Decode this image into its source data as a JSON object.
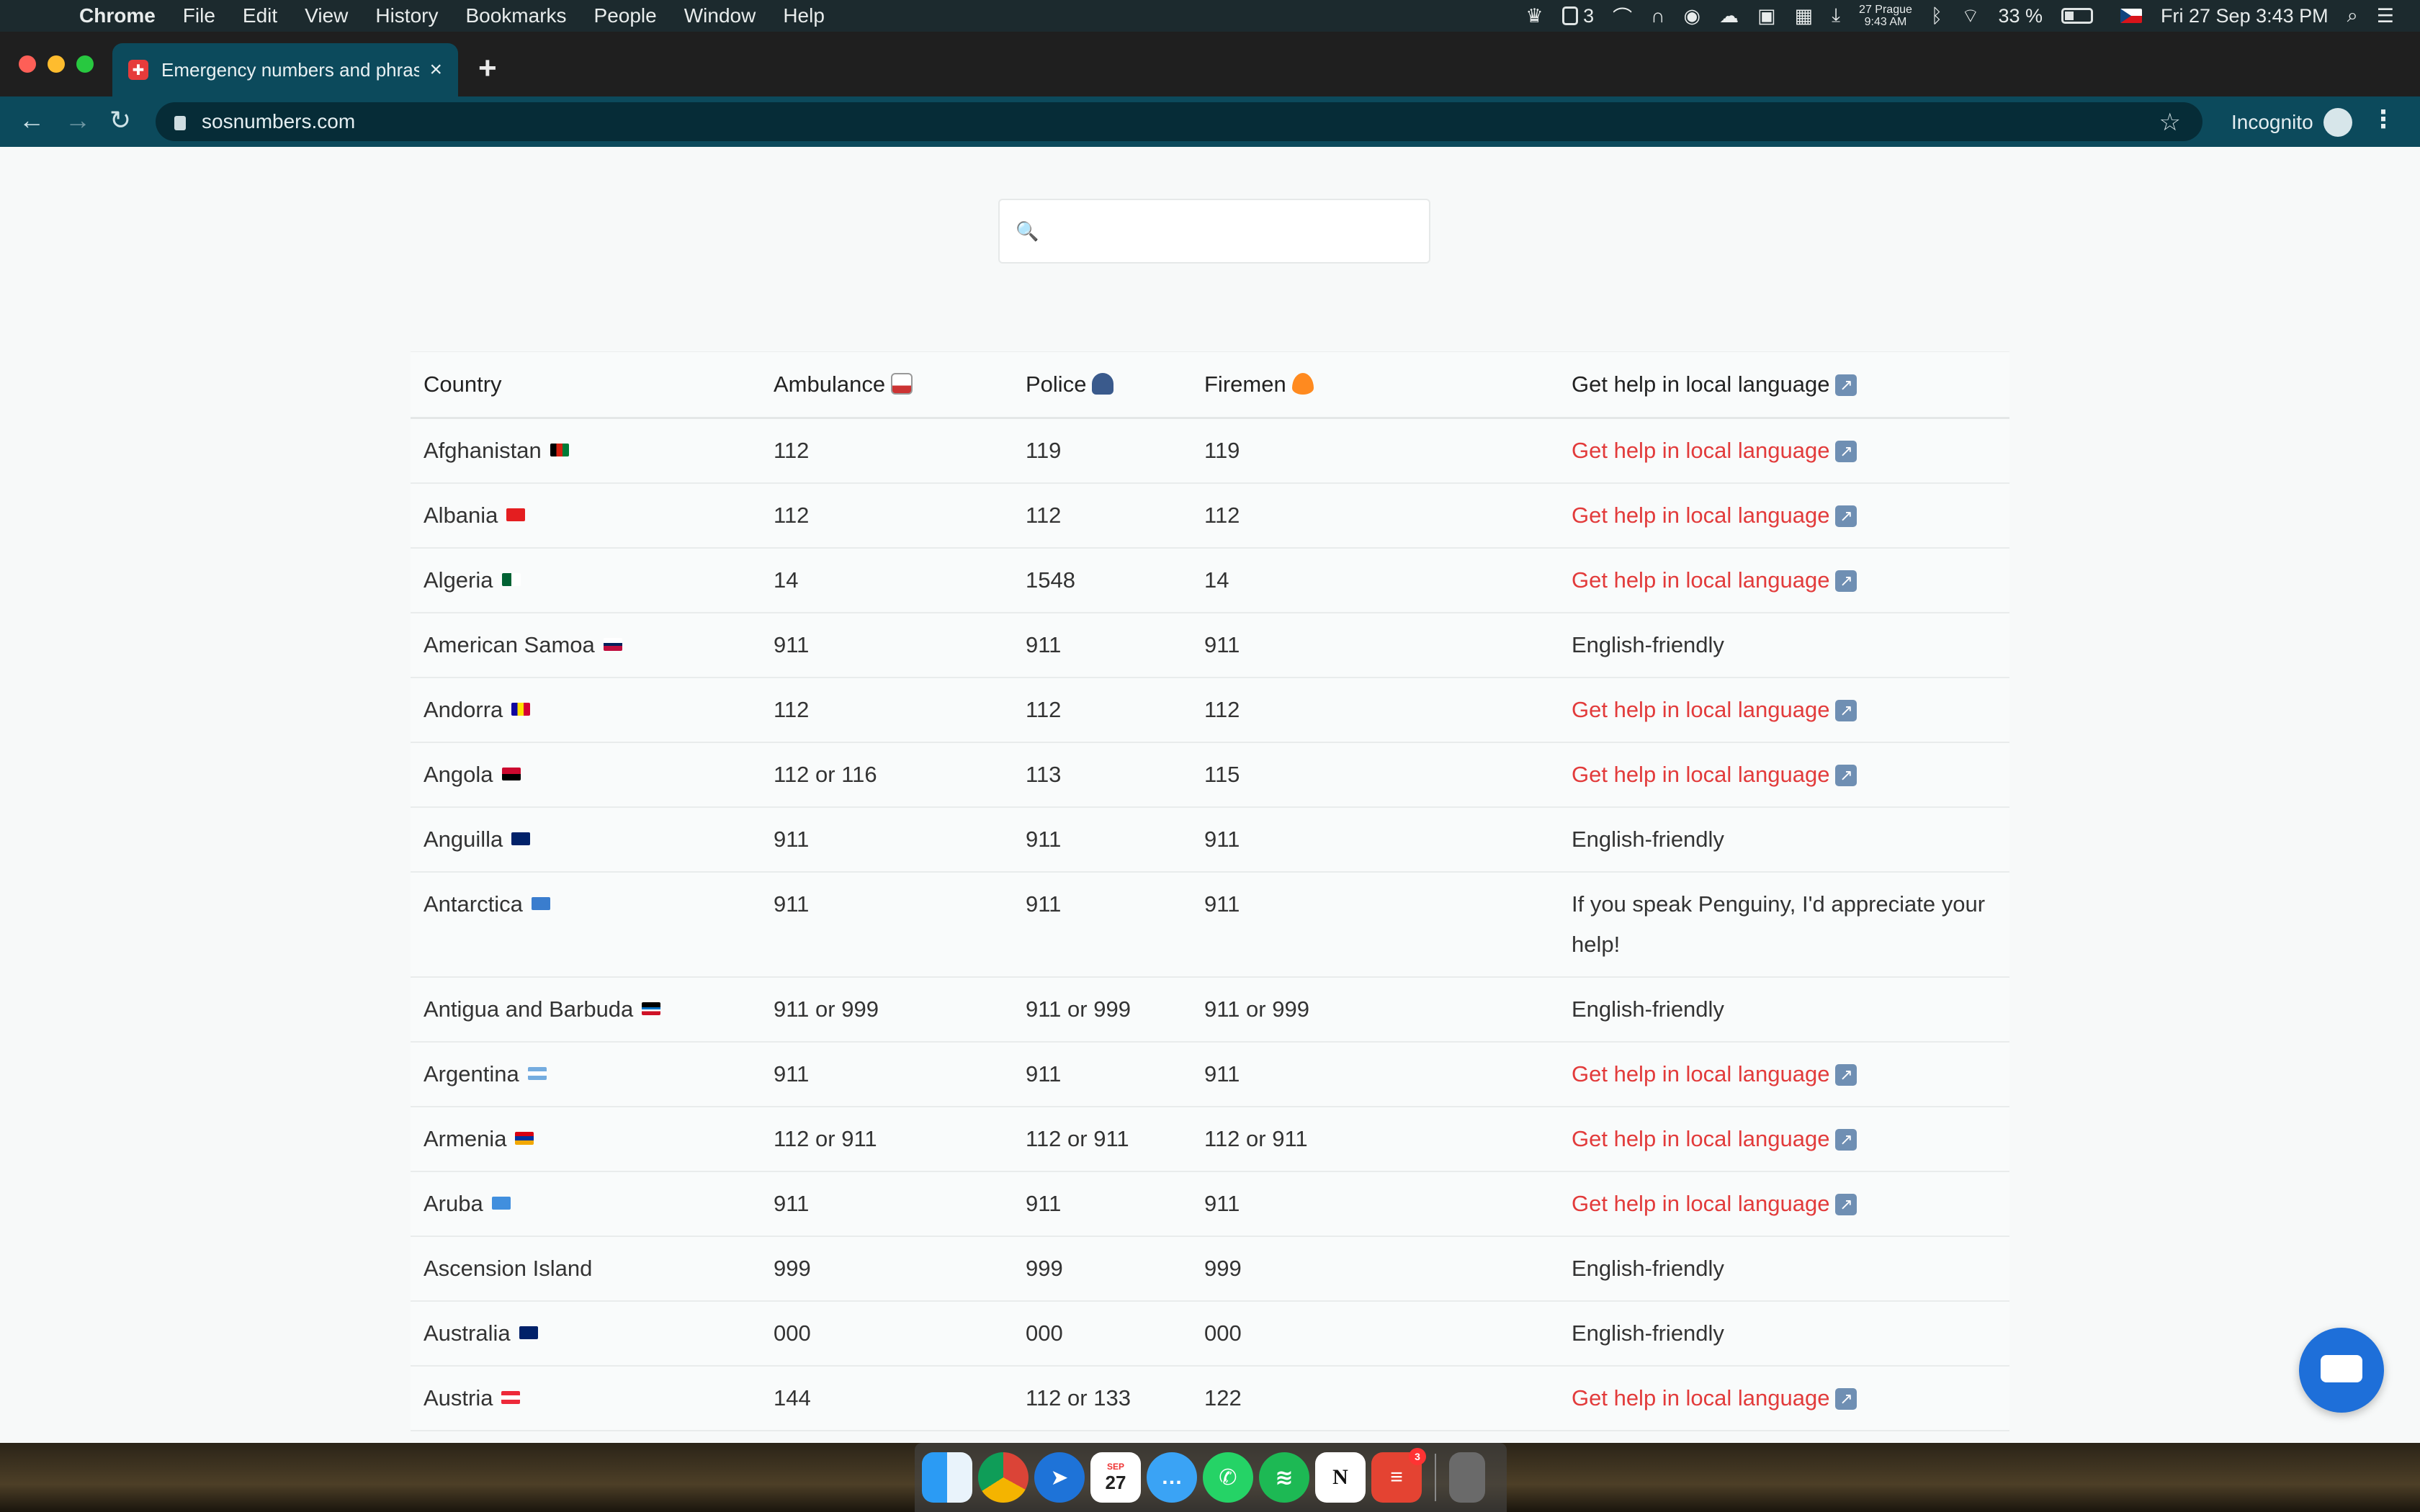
{
  "menubar": {
    "app": "Chrome",
    "items": [
      "File",
      "Edit",
      "View",
      "History",
      "Bookmarks",
      "People",
      "Window",
      "Help"
    ],
    "status": {
      "counter": "3",
      "clock_city": "27 Prague",
      "clock_time": "9:43 AM",
      "battery": "33 %",
      "datetime": "Fri 27 Sep  3:43 PM"
    }
  },
  "browser": {
    "tab_title": "Emergency numbers and phrases",
    "tab_close": "×",
    "new_tab": "+",
    "url": "sosnumbers.com",
    "incognito_label": "Incognito"
  },
  "search": {
    "placeholder": "",
    "value": ""
  },
  "table": {
    "headers": [
      "Country",
      "Ambulance",
      "Police",
      "Firemen",
      "Get help in local language"
    ],
    "rows": [
      {
        "country": "Afghanistan",
        "ambulance": "112",
        "police": "119",
        "firemen": "119",
        "help": "Get help in local language",
        "link": true
      },
      {
        "country": "Albania",
        "ambulance": "112",
        "police": "112",
        "firemen": "112",
        "help": "Get help in local language",
        "link": true
      },
      {
        "country": "Algeria",
        "ambulance": "14",
        "police": "1548",
        "firemen": "14",
        "help": "Get help in local language",
        "link": true
      },
      {
        "country": "American Samoa",
        "ambulance": "911",
        "police": "911",
        "firemen": "911",
        "help": "English-friendly",
        "link": false
      },
      {
        "country": "Andorra",
        "ambulance": "112",
        "police": "112",
        "firemen": "112",
        "help": "Get help in local language",
        "link": true
      },
      {
        "country": "Angola",
        "ambulance": "112 or 116",
        "police": "113",
        "firemen": "115",
        "help": "Get help in local language",
        "link": true
      },
      {
        "country": "Anguilla",
        "ambulance": "911",
        "police": "911",
        "firemen": "911",
        "help": "English-friendly",
        "link": false
      },
      {
        "country": "Antarctica",
        "ambulance": "911",
        "police": "911",
        "firemen": "911",
        "help": "If you speak Penguiny, I'd appreciate your help!",
        "link": false
      },
      {
        "country": "Antigua and Barbuda",
        "ambulance": "911 or 999",
        "police": "911 or 999",
        "firemen": "911 or 999",
        "help": "English-friendly",
        "link": false
      },
      {
        "country": "Argentina",
        "ambulance": "911",
        "police": "911",
        "firemen": "911",
        "help": "Get help in local language",
        "link": true
      },
      {
        "country": "Armenia",
        "ambulance": "112 or 911",
        "police": "112 or 911",
        "firemen": "112 or 911",
        "help": "Get help in local language",
        "link": true
      },
      {
        "country": "Aruba",
        "ambulance": "911",
        "police": "911",
        "firemen": "911",
        "help": "Get help in local language",
        "link": true
      },
      {
        "country": "Ascension Island",
        "ambulance": "999",
        "police": "999",
        "firemen": "999",
        "help": "English-friendly",
        "link": false
      },
      {
        "country": "Australia",
        "ambulance": "000",
        "police": "000",
        "firemen": "000",
        "help": "English-friendly",
        "link": false
      },
      {
        "country": "Austria",
        "ambulance": "144",
        "police": "112 or 133",
        "firemen": "122",
        "help": "Get help in local language",
        "link": true
      }
    ]
  },
  "colors": {
    "accent_link": "#e23b3b",
    "toolbar": "#0c4a5c",
    "page_bg": "#f7f9f9"
  },
  "dock": {
    "calendar_month": "SEP",
    "calendar_day": "27",
    "notion_letter": "N",
    "todoist_badge": "3"
  }
}
